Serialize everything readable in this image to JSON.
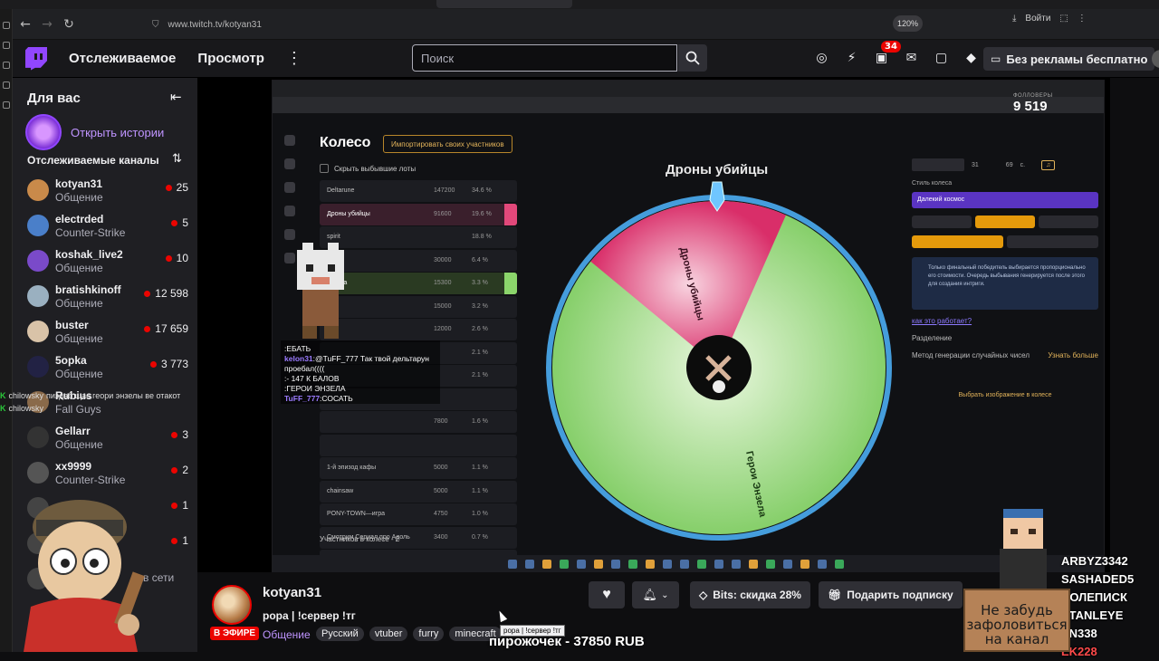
{
  "browser": {
    "url": "www.twitch.tv/kotyan31",
    "zoom": "120%",
    "login_label": "Войти"
  },
  "topnav": {
    "following": "Отслеживаемое",
    "browse": "Просмотр",
    "search_placeholder": "Поиск",
    "notifications_count": "34",
    "no_ads": "Без рекламы бесплатно"
  },
  "sidebar": {
    "title": "Для вас",
    "stories": "Открыть истории",
    "followed_heading": "Отслеживаемые каналы",
    "channels": [
      {
        "name": "kotyan31",
        "game": "Общение",
        "viewers": "25",
        "color": "#c98a4a"
      },
      {
        "name": "electrded",
        "game": "Counter-Strike",
        "viewers": "5",
        "color": "#4a7fc9"
      },
      {
        "name": "koshak_live2",
        "game": "Общение",
        "viewers": "10",
        "color": "#7a4ac9"
      },
      {
        "name": "bratishkinoff",
        "game": "Общение",
        "viewers": "12 598",
        "color": "#9ab0c0"
      },
      {
        "name": "buster",
        "game": "Общение",
        "viewers": "17 659",
        "color": "#d9c3a8"
      },
      {
        "name": "5opka",
        "game": "Общение",
        "viewers": "3 773",
        "color": "#222244"
      },
      {
        "name": "Rubius",
        "game": "Fall Guys",
        "viewers": "",
        "color": "#8a6a4a"
      },
      {
        "name": "Gellarr",
        "game": "Общение",
        "viewers": "3",
        "color": "#333333"
      },
      {
        "name": "xx9999",
        "game": "Counter-Strike",
        "viewers": "2",
        "color": "#555555"
      },
      {
        "name": "",
        "game": "",
        "viewers": "1",
        "color": "#444444"
      },
      {
        "name": "",
        "game": "",
        "viewers": "1",
        "color": "#444444"
      },
      {
        "name": "at1",
        "game": "",
        "viewers": "",
        "offline": "в сети",
        "color": "#444444"
      }
    ]
  },
  "stream_screen": {
    "wheel_title": "Колесо",
    "import_label": "Импортировать своих участников",
    "hide_lots": "Скрыть выбывшие лоты",
    "lots": [
      {
        "name": "Deltarune",
        "pts": "147200",
        "pct": "34.6 %",
        "hl": ""
      },
      {
        "name": "Дроны убийцы",
        "pts": "91600",
        "pct": "19.6 %",
        "hl": "pink"
      },
      {
        "name": "spirit",
        "pts": "",
        "pct": "18.8 %",
        "hl": ""
      },
      {
        "name": "",
        "pts": "30000",
        "pct": "6.4 %",
        "hl": ""
      },
      {
        "name": "энзела",
        "pts": "15300",
        "pct": "3.3 %",
        "hl": "green"
      },
      {
        "name": "",
        "pts": "15000",
        "pct": "3.2 %",
        "hl": ""
      },
      {
        "name": "",
        "pts": "12000",
        "pct": "2.6 %",
        "hl": ""
      },
      {
        "name": "",
        "pts": "",
        "pct": "2.1 %",
        "hl": ""
      },
      {
        "name": "",
        "pts": "",
        "pct": "2.1 %",
        "hl": ""
      },
      {
        "name": "",
        "pts": "",
        "pct": "",
        "hl": ""
      },
      {
        "name": "",
        "pts": "7800",
        "pct": "1.6 %",
        "hl": ""
      },
      {
        "name": "",
        "pts": "",
        "pct": "",
        "hl": ""
      },
      {
        "name": "1-й эпизод кафы",
        "pts": "5000",
        "pct": "1.1 %",
        "hl": ""
      },
      {
        "name": "chainsaw",
        "pts": "5000",
        "pct": "1.1 %",
        "hl": ""
      },
      {
        "name": "PONY-TOWN—игра",
        "pts": "4750",
        "pct": "1.0 %",
        "hl": ""
      },
      {
        "name": "Смотрим Сериал про Адоль",
        "pts": "3400",
        "pct": "0.7 %",
        "hl": ""
      },
      {
        "name": "FNAF8",
        "pts": "2700",
        "pct": "0.6 %",
        "hl": ""
      }
    ],
    "lots_count": "Участников в колесе - 2",
    "wheel_name": "Дроны убийцы",
    "slice_a": "Дроны убийцы",
    "slice_b": "Герои Энзела",
    "style_label": "Стиль колеса",
    "style_value": "Далекий космос",
    "info_text": "Только финальный победитель выбирается пропорционально его стоимости. Очередь выбывания генерируется после этого для создания интриги.",
    "how_link": "как это работает?",
    "split_label": "Разделение",
    "rng_label": "Метод генерации случайных чисел",
    "rng_link": "Узнать больше",
    "image_link": "Выбрать изображение в колесе",
    "time_a": "31",
    "time_b": "69",
    "time_unit": "с.",
    "counter_label": "ФОЛЛОВЕРЫ",
    "counter_value": "9 519",
    "pct_a": 0.196,
    "pct_b": 0.033
  },
  "overlay_chat": [
    {
      "user": "",
      "msg": "ЕБАТЬ"
    },
    {
      "user": "kelon31",
      "msg": "@TuFF_777 Так твой дельтарун проебал(((("
    },
    {
      "user": "",
      "msg": "- 147 К БАЛОВ"
    },
    {
      "user": "",
      "msg": "ГЕРОИ ЭНЗЕЛА"
    },
    {
      "user": "TuFF_777",
      "msg": "СОСАТЬ"
    }
  ],
  "side_chat": [
    {
      "user": "chilowsky",
      "msg": "пиздаб щас геори энзелы ве отакот"
    },
    {
      "user": "chilowsky",
      "msg": ""
    }
  ],
  "info": {
    "live": "В ЭФИРЕ",
    "streamer": "kotyan31",
    "title": "рора | !сервер !тг",
    "category": "Общение",
    "tags": [
      "Русский",
      "vtuber",
      "furry",
      "minecraft"
    ],
    "bits": "Bits: скидка 28%",
    "gift": "Подарить подписку",
    "ticker": "пирожочек - 37850 RUB",
    "tooltip": "рора | !сервер !тг"
  },
  "overlay_subs": {
    "names": [
      "ARBYZ3342",
      "SASHADED5",
      "ПОЛЕПИСК",
      "STANLEYE",
      "EN338",
      "EK228"
    ],
    "sign": "Не забудь зафоловиться на канал"
  },
  "colors": {
    "twitch_purple": "#9146ff",
    "live_red": "#eb0400",
    "wheel_pink": "#e2487a",
    "wheel_green": "#8bd56b"
  }
}
